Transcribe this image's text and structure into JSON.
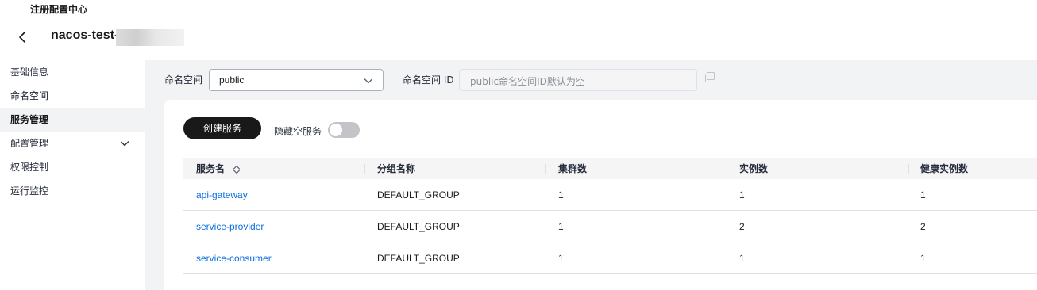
{
  "header": {
    "breadcrumb": "注册配置中心",
    "title": "nacos-test-"
  },
  "sidebar": {
    "items": [
      {
        "label": "基础信息"
      },
      {
        "label": "命名空间"
      },
      {
        "label": "服务管理"
      },
      {
        "label": "配置管理"
      },
      {
        "label": "权限控制"
      },
      {
        "label": "运行监控"
      }
    ]
  },
  "filters": {
    "namespace_label": "命名空间",
    "namespace_value": "public",
    "namespace_id_label": "命名空间 ID",
    "namespace_id_placeholder": "public命名空间ID默认为空"
  },
  "toolbar": {
    "create_label": "创建服务",
    "hide_empty_label": "隐藏空服务",
    "hide_empty_on": false
  },
  "table": {
    "columns": [
      "服务名",
      "分组名称",
      "集群数",
      "实例数",
      "健康实例数"
    ],
    "rows": [
      [
        "api-gateway",
        "DEFAULT_GROUP",
        "1",
        "1",
        "1"
      ],
      [
        "service-provider",
        "DEFAULT_GROUP",
        "1",
        "2",
        "2"
      ],
      [
        "service-consumer",
        "DEFAULT_GROUP",
        "1",
        "1",
        "1"
      ]
    ]
  },
  "colors": {
    "accent_link": "#0b6ee0",
    "primary_button": "#191919",
    "background": "#f2f3f5"
  }
}
